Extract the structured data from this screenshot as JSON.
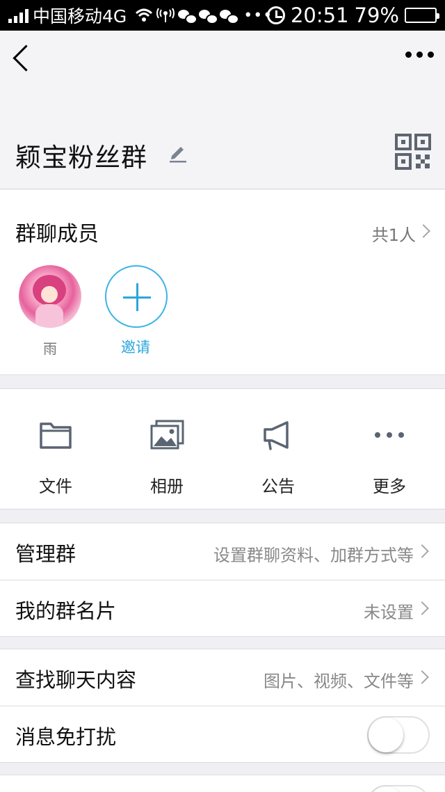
{
  "status_bar": {
    "carrier": "中国移动4G",
    "dots": "•••",
    "time": "20:51",
    "battery": "79%",
    "battery_level": 0.79
  },
  "nav": {
    "back_icon": "chevron-left-icon",
    "more_icon": "more-dots-icon"
  },
  "header": {
    "group_name": "颖宝粉丝群",
    "edit_icon": "pencil-icon",
    "qr_icon": "qr-code-icon"
  },
  "members": {
    "title": "群聊成员",
    "count": "共1人",
    "list": [
      {
        "name": "雨"
      }
    ],
    "invite_label": "邀请"
  },
  "functions": [
    {
      "label": "文件",
      "icon": "folder-icon"
    },
    {
      "label": "相册",
      "icon": "album-icon"
    },
    {
      "label": "公告",
      "icon": "megaphone-icon"
    },
    {
      "label": "更多",
      "icon": "more-icon"
    }
  ],
  "settings_group_1": [
    {
      "label": "管理群",
      "value": "设置群聊资料、加群方式等"
    },
    {
      "label": "我的群名片",
      "value": "未设置"
    }
  ],
  "settings_group_2": [
    {
      "label": "查找聊天内容",
      "value": "图片、视频、文件等"
    },
    {
      "label": "消息免打扰",
      "toggle": false
    }
  ],
  "colors": {
    "accent": "#2aa6dc",
    "icon_gray": "#5a6472",
    "background": "#efeff4"
  }
}
